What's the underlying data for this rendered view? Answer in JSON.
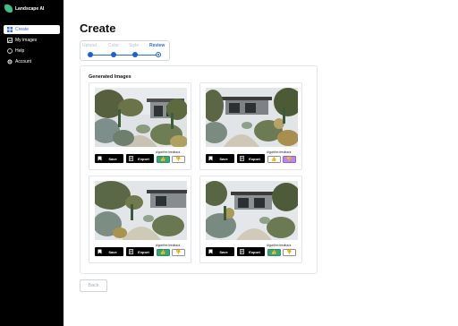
{
  "app": {
    "name": "Landscape AI"
  },
  "sidebar": {
    "items": [
      {
        "label": "Create",
        "icon": "grid-icon",
        "active": true
      },
      {
        "label": "My images",
        "icon": "image-icon",
        "active": false
      },
      {
        "label": "Help",
        "icon": "help-icon",
        "active": false
      },
      {
        "label": "Account",
        "icon": "gear-icon",
        "active": false
      }
    ]
  },
  "page": {
    "title": "Create"
  },
  "stepper": {
    "steps": [
      "Upload",
      "Color",
      "Style",
      "Review"
    ],
    "current_index": 3
  },
  "generated": {
    "title": "Generated Images",
    "images": [
      {
        "save_label": "Save",
        "export_label": "Export",
        "feedback_label": "Algorithm feedback",
        "thumbs_up": "👍",
        "thumbs_down": "👎",
        "down_state": "default"
      },
      {
        "save_label": "Save",
        "export_label": "Export",
        "feedback_label": "Algorithm feedback",
        "thumbs_up": "👍",
        "thumbs_down": "👎",
        "down_state": "selected"
      },
      {
        "save_label": "Save",
        "export_label": "Export",
        "feedback_label": "Algorithm feedback",
        "thumbs_up": "👍",
        "thumbs_down": "👎",
        "down_state": "default"
      },
      {
        "save_label": "Save",
        "export_label": "Export",
        "feedback_label": "Algorithm feedback",
        "thumbs_up": "👍",
        "thumbs_down": "👎",
        "down_state": "default"
      }
    ]
  },
  "footer": {
    "back_label": "Back"
  },
  "colors": {
    "accent": "#2d6cdf",
    "thumbs_up": "#3aa57a",
    "thumbs_down_selected": "#b58be6",
    "sidebar_bg": "#000000"
  }
}
